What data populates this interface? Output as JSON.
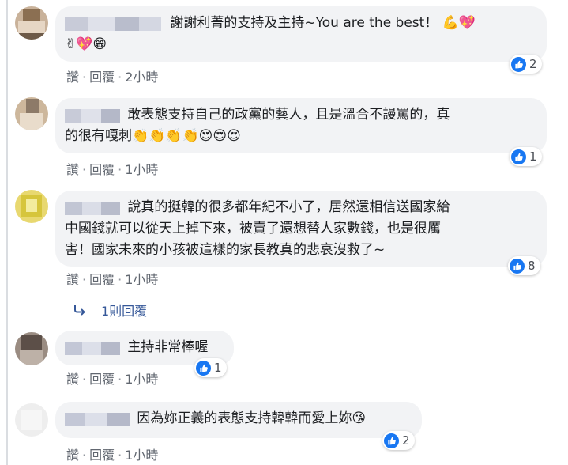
{
  "comments": [
    {
      "text": "謝謝利菁的支持及主持~You are the best！",
      "emojis": "💪💖",
      "emojis_line2": "✌💖😁",
      "actions": {
        "like": "讚",
        "reply": "回覆",
        "time": "2小時"
      },
      "reaction_count": "2"
    },
    {
      "text_line1": "敢表態支持自己的政黨的藝人，且是溫合不謾罵的，真",
      "text_line2": "的很有嘎刺",
      "emojis": "👏👏👏👏😍😍😍",
      "actions": {
        "like": "讚",
        "reply": "回覆",
        "time": "1小時"
      },
      "reaction_count": "1"
    },
    {
      "text_line1": "說真的挺韓的很多都年紀不小了，居然還相信送國家給",
      "text_line2": "中國錢就可以從天上掉下來，被賣了還想替人家數錢，也是很厲",
      "text_line3": "害！國家未來的小孩被這樣的家長教真的悲哀沒救了~",
      "actions": {
        "like": "讚",
        "reply": "回覆",
        "time": "1小時"
      },
      "reaction_count": "8",
      "replies_label": "1則回覆"
    },
    {
      "text": "主持非常棒喔",
      "actions": {
        "like": "讚",
        "reply": "回覆",
        "time": "1小時"
      },
      "reaction_count": "1"
    },
    {
      "text": "因為妳正義的表態支持韓韓而愛上妳",
      "emojis": "😘",
      "actions": {
        "like": "讚",
        "reply": "回覆",
        "time": "1小時"
      },
      "reaction_count": "2"
    }
  ],
  "separator": "·",
  "colors": {
    "bubble": "#f2f3f5",
    "like_blue": "#1877f2",
    "link": "#365899",
    "meta": "#616770"
  },
  "icons": {
    "like": "thumbs-up-icon",
    "reply_arrow": "reply-arrow-icon"
  }
}
